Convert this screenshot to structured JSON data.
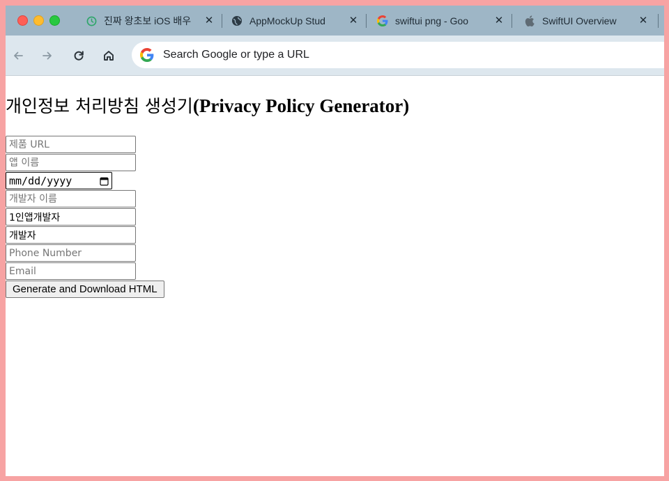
{
  "theme": {
    "frame": "#f7a3a3",
    "tab_strip": "#9eb6c6",
    "toolbar": "#dde7ee"
  },
  "tabs": [
    {
      "title": "진짜 왕초보 iOS 배우",
      "icon": "green-clock-icon",
      "close": "✕"
    },
    {
      "title": "AppMockUp Stud",
      "icon": "globe-icon",
      "close": "✕"
    },
    {
      "title": "swiftui png - Goo",
      "icon": "google-g-icon",
      "close": "✕"
    },
    {
      "title": "SwiftUI Overview",
      "icon": "apple-icon",
      "close": "✕"
    }
  ],
  "toolbar": {
    "back_icon": "back-arrow-icon",
    "forward_icon": "forward-arrow-icon",
    "reload_icon": "reload-icon",
    "home_icon": "home-icon",
    "omnibox_placeholder": "Search Google or type a URL"
  },
  "page": {
    "title_korean": "개인정보 처리방침 생성기",
    "title_english": "(Privacy Policy Generator)",
    "fields": {
      "product_url_placeholder": "제품 URL",
      "app_name_placeholder": "앱 이름",
      "date_placeholder": "mm/dd/yyyy",
      "developer_name_placeholder": "개발자 이름",
      "developer_type_value": "1인앱개발자",
      "developer_role_value": "개발자",
      "phone_placeholder": "Phone Number",
      "email_placeholder": "Email"
    },
    "generate_button": "Generate and Download HTML"
  }
}
